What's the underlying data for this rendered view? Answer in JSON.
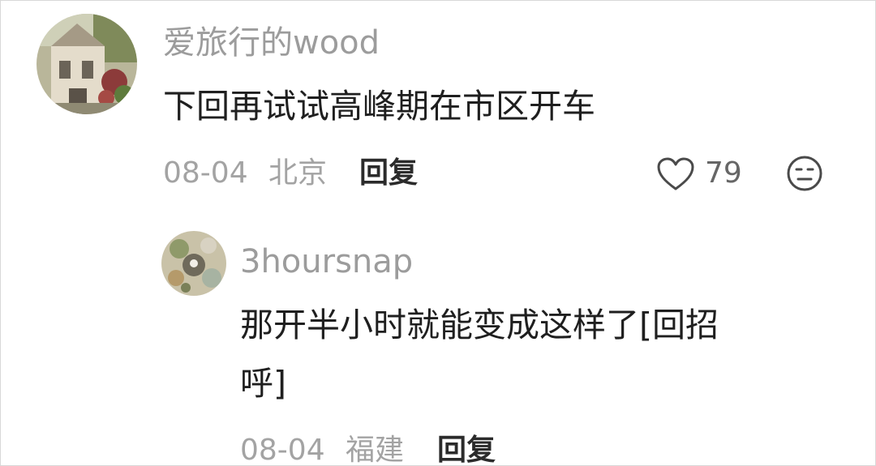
{
  "comment": {
    "username": "爱旅行的wood",
    "text": "下回再试试高峰期在市区开车",
    "date": "08-04",
    "location": "北京",
    "reply_label": "回复",
    "like_count": "79"
  },
  "reply": {
    "username": "3hoursnap",
    "text_line1": "那开半小时就能变成这样了[回招",
    "text_line2": "呼]",
    "date": "08-04",
    "location": "福建",
    "reply_label": "回复"
  },
  "icons": {
    "like": "heart-outline-icon",
    "dislike": "meh-face-icon"
  }
}
